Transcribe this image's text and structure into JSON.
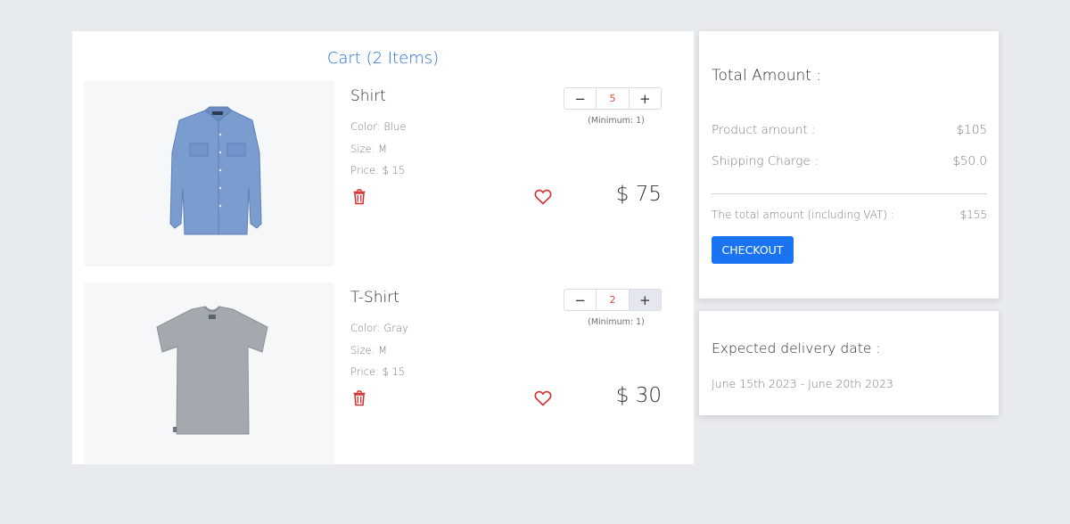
{
  "cart": {
    "title": "Cart (2 Items)",
    "items": [
      {
        "name": "Shirt",
        "color": "Color: Blue",
        "size": "Size: M",
        "price": "Price: $ 15",
        "quantity": "5",
        "minimum": "(Minimum: 1)",
        "total": "$ 75",
        "image_icon": "shirt-image",
        "dec_label": "−",
        "inc_label": "+"
      },
      {
        "name": "T-Shirt",
        "color": "Color: Gray",
        "size": "Size: M",
        "price": "Price: $ 15",
        "quantity": "2",
        "minimum": "(Minimum: 1)",
        "total": "$ 30",
        "image_icon": "tshirt-image",
        "dec_label": "−",
        "inc_label": "+"
      }
    ]
  },
  "summary": {
    "title": "Total Amount :",
    "product_label": "Product amount :",
    "product_value": "$105",
    "shipping_label": "Shipping Charge :",
    "shipping_value": "$50.0",
    "total_label": "The total amount (including VAT) :",
    "total_value": "$155",
    "checkout_label": "CHECKOUT"
  },
  "delivery": {
    "title": "Expected delivery date :",
    "dates": "June 15th 2023 - June 20th 2023"
  },
  "colors": {
    "accent": "#1a73f0",
    "title_blue": "#1f6fde",
    "danger": "#d32f2f",
    "background": "#e8ebee"
  },
  "icons": {
    "delete": "trash-icon",
    "wishlist": "heart-icon"
  }
}
